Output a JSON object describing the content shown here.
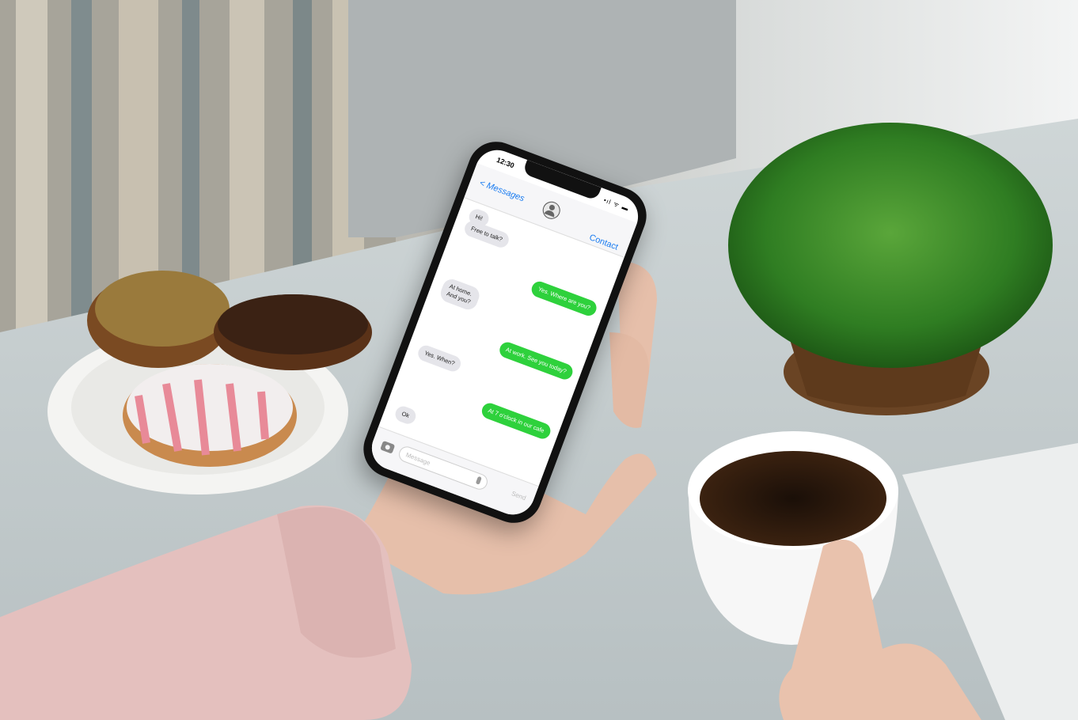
{
  "phone": {
    "status_time": "12:30",
    "status_icons": "•ıl ᯤ ▬",
    "back_label": "< Messages",
    "contact_label": "Contact",
    "messages": [
      {
        "dir": "in",
        "text": "Hi!"
      },
      {
        "dir": "in",
        "text": "Free to talk?"
      },
      {
        "dir": "out",
        "text": "Yes. Where are you?"
      },
      {
        "dir": "in",
        "text": "At home.\nAnd you?"
      },
      {
        "dir": "out",
        "text": "At work. See you today?"
      },
      {
        "dir": "in",
        "text": "Yes. When?"
      },
      {
        "dir": "out",
        "text": "At 7 o'clock in our cafe"
      },
      {
        "dir": "in",
        "text": "Ok"
      }
    ],
    "input_placeholder": "Message",
    "send_label": "Send"
  },
  "colors": {
    "outgoing_bubble": "#2ed13c",
    "incoming_bubble": "#e5e5ea",
    "ios_blue": "#1b7cf0"
  }
}
